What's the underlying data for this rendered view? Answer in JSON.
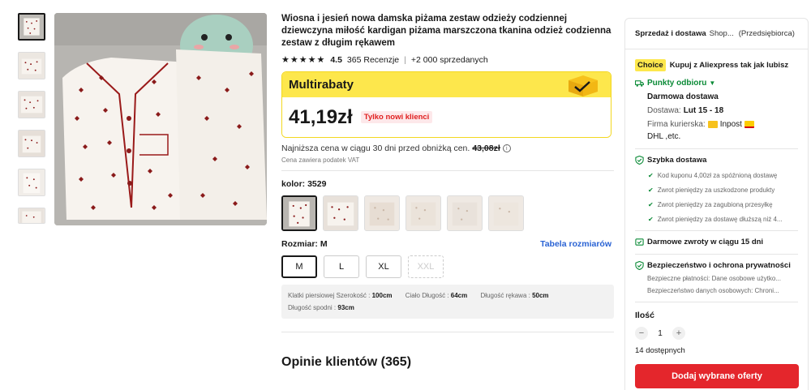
{
  "product": {
    "title": "Wiosna i jesień nowa damska piżama zestaw odzieży codziennej dziewczyna miłość kardigan piżama marszczona tkanina odzież codzienna zestaw z długim rękawem",
    "rating_stars": "★★★★★",
    "rating": "4.5",
    "reviews": "365 Recenzje",
    "sold": "+2 000 sprzedanych"
  },
  "deal": {
    "label": "Multirabaty",
    "price": "41,19zł",
    "badge": "Tylko nowi klienci"
  },
  "lowest_price": {
    "text": "Najniższa cena w ciągu 30 dni przed obniżką cen.",
    "old_price": "43,08zł",
    "vat": "Cena zawiera podatek VAT"
  },
  "color": {
    "label": "kolor: 3529"
  },
  "size": {
    "label": "Rozmiar: M",
    "table_link": "Tabela rozmiarów",
    "options": [
      "M",
      "L",
      "XL",
      "XXL"
    ]
  },
  "measurements": {
    "chest_label": "Klatki piersiowej Szerokość : ",
    "chest_value": "100cm",
    "body_label": "Ciało Długość : ",
    "body_value": "64cm",
    "sleeve_label": "Długość rękawa : ",
    "sleeve_value": "50cm",
    "pants_label": "Długość spodni : ",
    "pants_value": "93cm"
  },
  "opinions_title": "Opinie klientów (365)",
  "panel": {
    "seller_label": "Sprzedaż i dostawa",
    "shop": "Shop...",
    "seller_type": "(Przedsiębiorca)",
    "choice_badge": "Choice",
    "choice_text": "Kupuj z Aliexpress tak jak lubisz",
    "pickup": "Punkty odbioru",
    "free_delivery": "Darmowa dostawa",
    "delivery_label": "Dostawa:",
    "delivery_date": "Lut 15 - 18",
    "courier_label": "Firma kurierska:",
    "courier_inpost": "Inpost",
    "courier_rest": "DHL ,etc.",
    "fast_delivery": "Szybka dostawa",
    "fast_items": [
      "Kod kuponu 4,00zł za spóźnioną dostawę",
      "Zwrot pieniędzy za uszkodzone produkty",
      "Zwrot pieniędzy za zagubioną przesyłkę",
      "Zwrot pieniędzy za dostawę dłuższą niż 4..."
    ],
    "free_returns": "Darmowe zwroty w ciągu 15 dni",
    "security": "Bezpieczeństwo i ochrona prywatności",
    "security_items": [
      "Bezpieczne płatności: Dane osobowe użytko...",
      "Bezpieczeństwo danych osobowych: Chroni..."
    ],
    "qty_label": "Ilość",
    "qty_minus": "−",
    "qty_value": "1",
    "qty_plus": "+",
    "available": "14 dostępnych",
    "add_button": "Dodaj wybrane oferty"
  },
  "colors": {
    "brand_red": "#e4262c",
    "deal_yellow": "#fde74c",
    "link_blue": "#2a63d4",
    "success_green": "#0a8a36"
  }
}
